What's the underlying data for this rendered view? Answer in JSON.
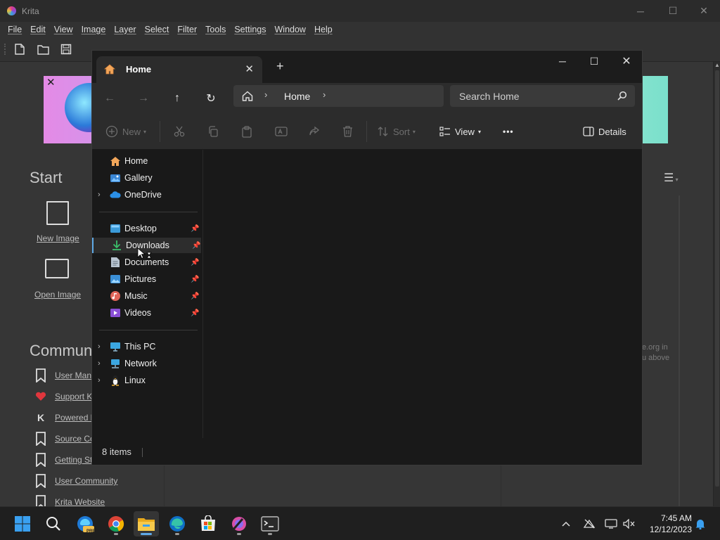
{
  "krita": {
    "title": "Krita",
    "menu": [
      "File",
      "Edit",
      "View",
      "Image",
      "Layer",
      "Select",
      "Filter",
      "Tools",
      "Settings",
      "Window",
      "Help"
    ],
    "start": {
      "title": "Start",
      "new_image": "New Image",
      "open_image": "Open Image"
    },
    "community": {
      "title": "Community",
      "links": [
        "User Manual",
        "Support Krita",
        "Powered by KDE",
        "Source Code",
        "Getting Started",
        "User Community",
        "Krita Website"
      ]
    },
    "side_text": [
      "e.org in",
      "u above"
    ]
  },
  "explorer": {
    "tab": {
      "label": "Home",
      "close": "✕",
      "new_tab": "+"
    },
    "window_controls": [
      "─",
      "☐",
      "✕"
    ],
    "nav": {
      "back": "←",
      "forward": "→",
      "up": "↑",
      "refresh": "↻"
    },
    "address": {
      "crumb": "Home",
      "sep": "›"
    },
    "search": {
      "placeholder": "Search Home"
    },
    "commands": {
      "new": "New",
      "sort": "Sort",
      "view": "View",
      "more": "•••",
      "details": "Details"
    },
    "sidebar": {
      "quick": [
        {
          "label": "Home",
          "icon": "home-icon"
        },
        {
          "label": "Gallery",
          "icon": "gallery-icon"
        },
        {
          "label": "OneDrive",
          "icon": "cloud-icon",
          "expandable": true
        }
      ],
      "pinned": [
        {
          "label": "Desktop",
          "icon": "desktop-icon"
        },
        {
          "label": "Downloads",
          "icon": "download-icon"
        },
        {
          "label": "Documents",
          "icon": "document-icon"
        },
        {
          "label": "Pictures",
          "icon": "pictures-icon"
        },
        {
          "label": "Music",
          "icon": "music-icon"
        },
        {
          "label": "Videos",
          "icon": "videos-icon"
        }
      ],
      "locations": [
        {
          "label": "This PC",
          "icon": "pc-icon"
        },
        {
          "label": "Network",
          "icon": "network-icon"
        },
        {
          "label": "Linux",
          "icon": "linux-icon"
        }
      ]
    },
    "status": {
      "items": "8 items"
    }
  },
  "taskbar": {
    "apps": [
      "windows-start-icon",
      "search-icon",
      "edge-preview-icon",
      "chrome-icon",
      "file-explorer-icon",
      "edge-icon",
      "store-icon",
      "krita-icon",
      "terminal-icon"
    ],
    "badge_pre": "PRE",
    "time": "7:45 AM",
    "date": "12/12/2023"
  },
  "colors": {
    "accent": "#5fa9e6",
    "folder": "#f2c14e",
    "explorer_bg": "#191919",
    "krita_bg": "#363636"
  }
}
